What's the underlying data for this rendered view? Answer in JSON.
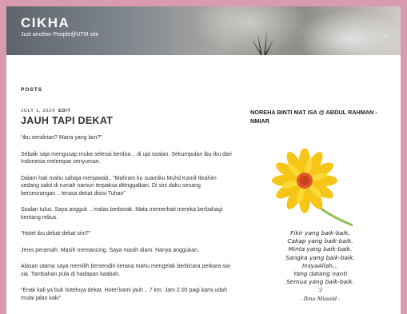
{
  "header": {
    "site_title": "CIKHA",
    "site_description": "Just another People@UTM site",
    "scroll_icon": "arrow-down-icon",
    "scroll_glyph": "↓"
  },
  "main": {
    "section_heading": "POSTS",
    "post": {
      "date": "JULY 1, 2024",
      "edit_label": "EDIT",
      "title": "JAUH TAPI DEKAT",
      "paragraphs": [
        "“ibu sendirian? Mana yang lain?”",
        "Sebaik saja mengusap muka selesai berdoa .. di uja soalan. Sekumpulan ibu-ibu dari Indonesia melempar senyuman.",
        "Dalam hati mahu sahaja menjawab.. “Mahram ku suamiku Muhd Kamil Ibrahim sedang sakit di rumah namun terpaksa ditinggalkan. Di sini daku senang berseorangan .. terasa dekat disisi Tuhan”",
        "Soalan tulus. Saya angguk .. malas berborak. Mata memerhati mereka berbahagi kentang rebus.",
        "“Hotel ibu dekat-dekat sini?”",
        "Jenis peramah. Masih memancing. Saya masih diam. Hanya anggukan.",
        "Alasan utama saya memilih bersendiri kerana mahu mengelak berbicara perkara sia-sia. Tambahan pula di hadapan kaabah.",
        "“Enak kali ya buk hotelnya dekat. Hotel kami jauh .. 7 km. Jam 2.00 pagi kami udah mulai jalan kaki”"
      ]
    }
  },
  "sidebar": {
    "widget_title": "NOREHA BINTI MAT ISA @ ABDUL RAHMAN - NMIAR",
    "image_icon": "flower-image",
    "quote_lines": [
      "Fikir yang baik-baik.",
      "Cakap yang baik-baik.",
      "Minta yang baik-baik.",
      "Sangka yang baik-baik.",
      "InsyaAllah...",
      "Yang datang nanti",
      "Semua yang baik-baik.",
      ":)"
    ],
    "quote_author": "- Ibnu Musaid -"
  },
  "colors": {
    "page_border": "#d99bb0",
    "header_text": "#ffffff",
    "flower_petal": "#f7c515",
    "flower_center": "#e2582a"
  }
}
